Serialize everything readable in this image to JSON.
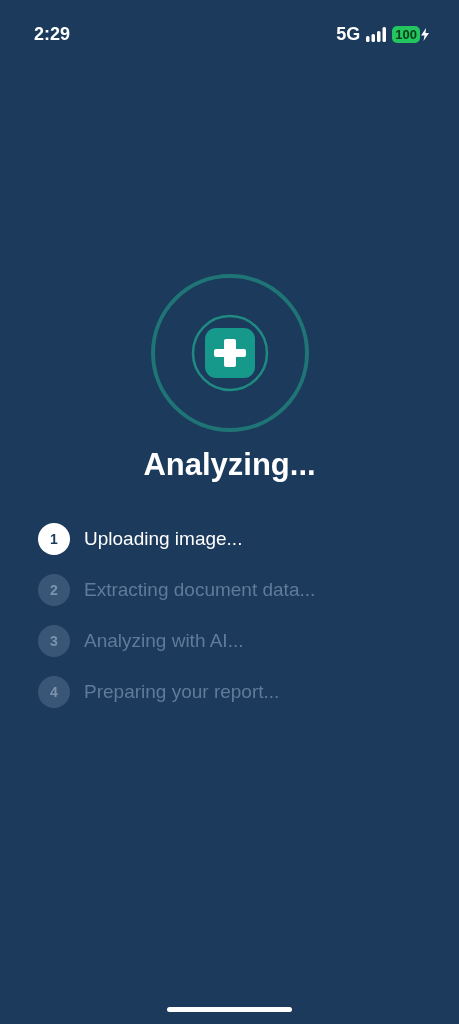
{
  "status_bar": {
    "time": "2:29",
    "network": "5G",
    "battery": "100",
    "charging": true
  },
  "title": "Analyzing...",
  "steps": [
    {
      "number": "1",
      "label": "Uploading image...",
      "active": true
    },
    {
      "number": "2",
      "label": "Extracting document data...",
      "active": false
    },
    {
      "number": "3",
      "label": "Analyzing with AI...",
      "active": false
    },
    {
      "number": "4",
      "label": "Preparing your report...",
      "active": false
    }
  ]
}
